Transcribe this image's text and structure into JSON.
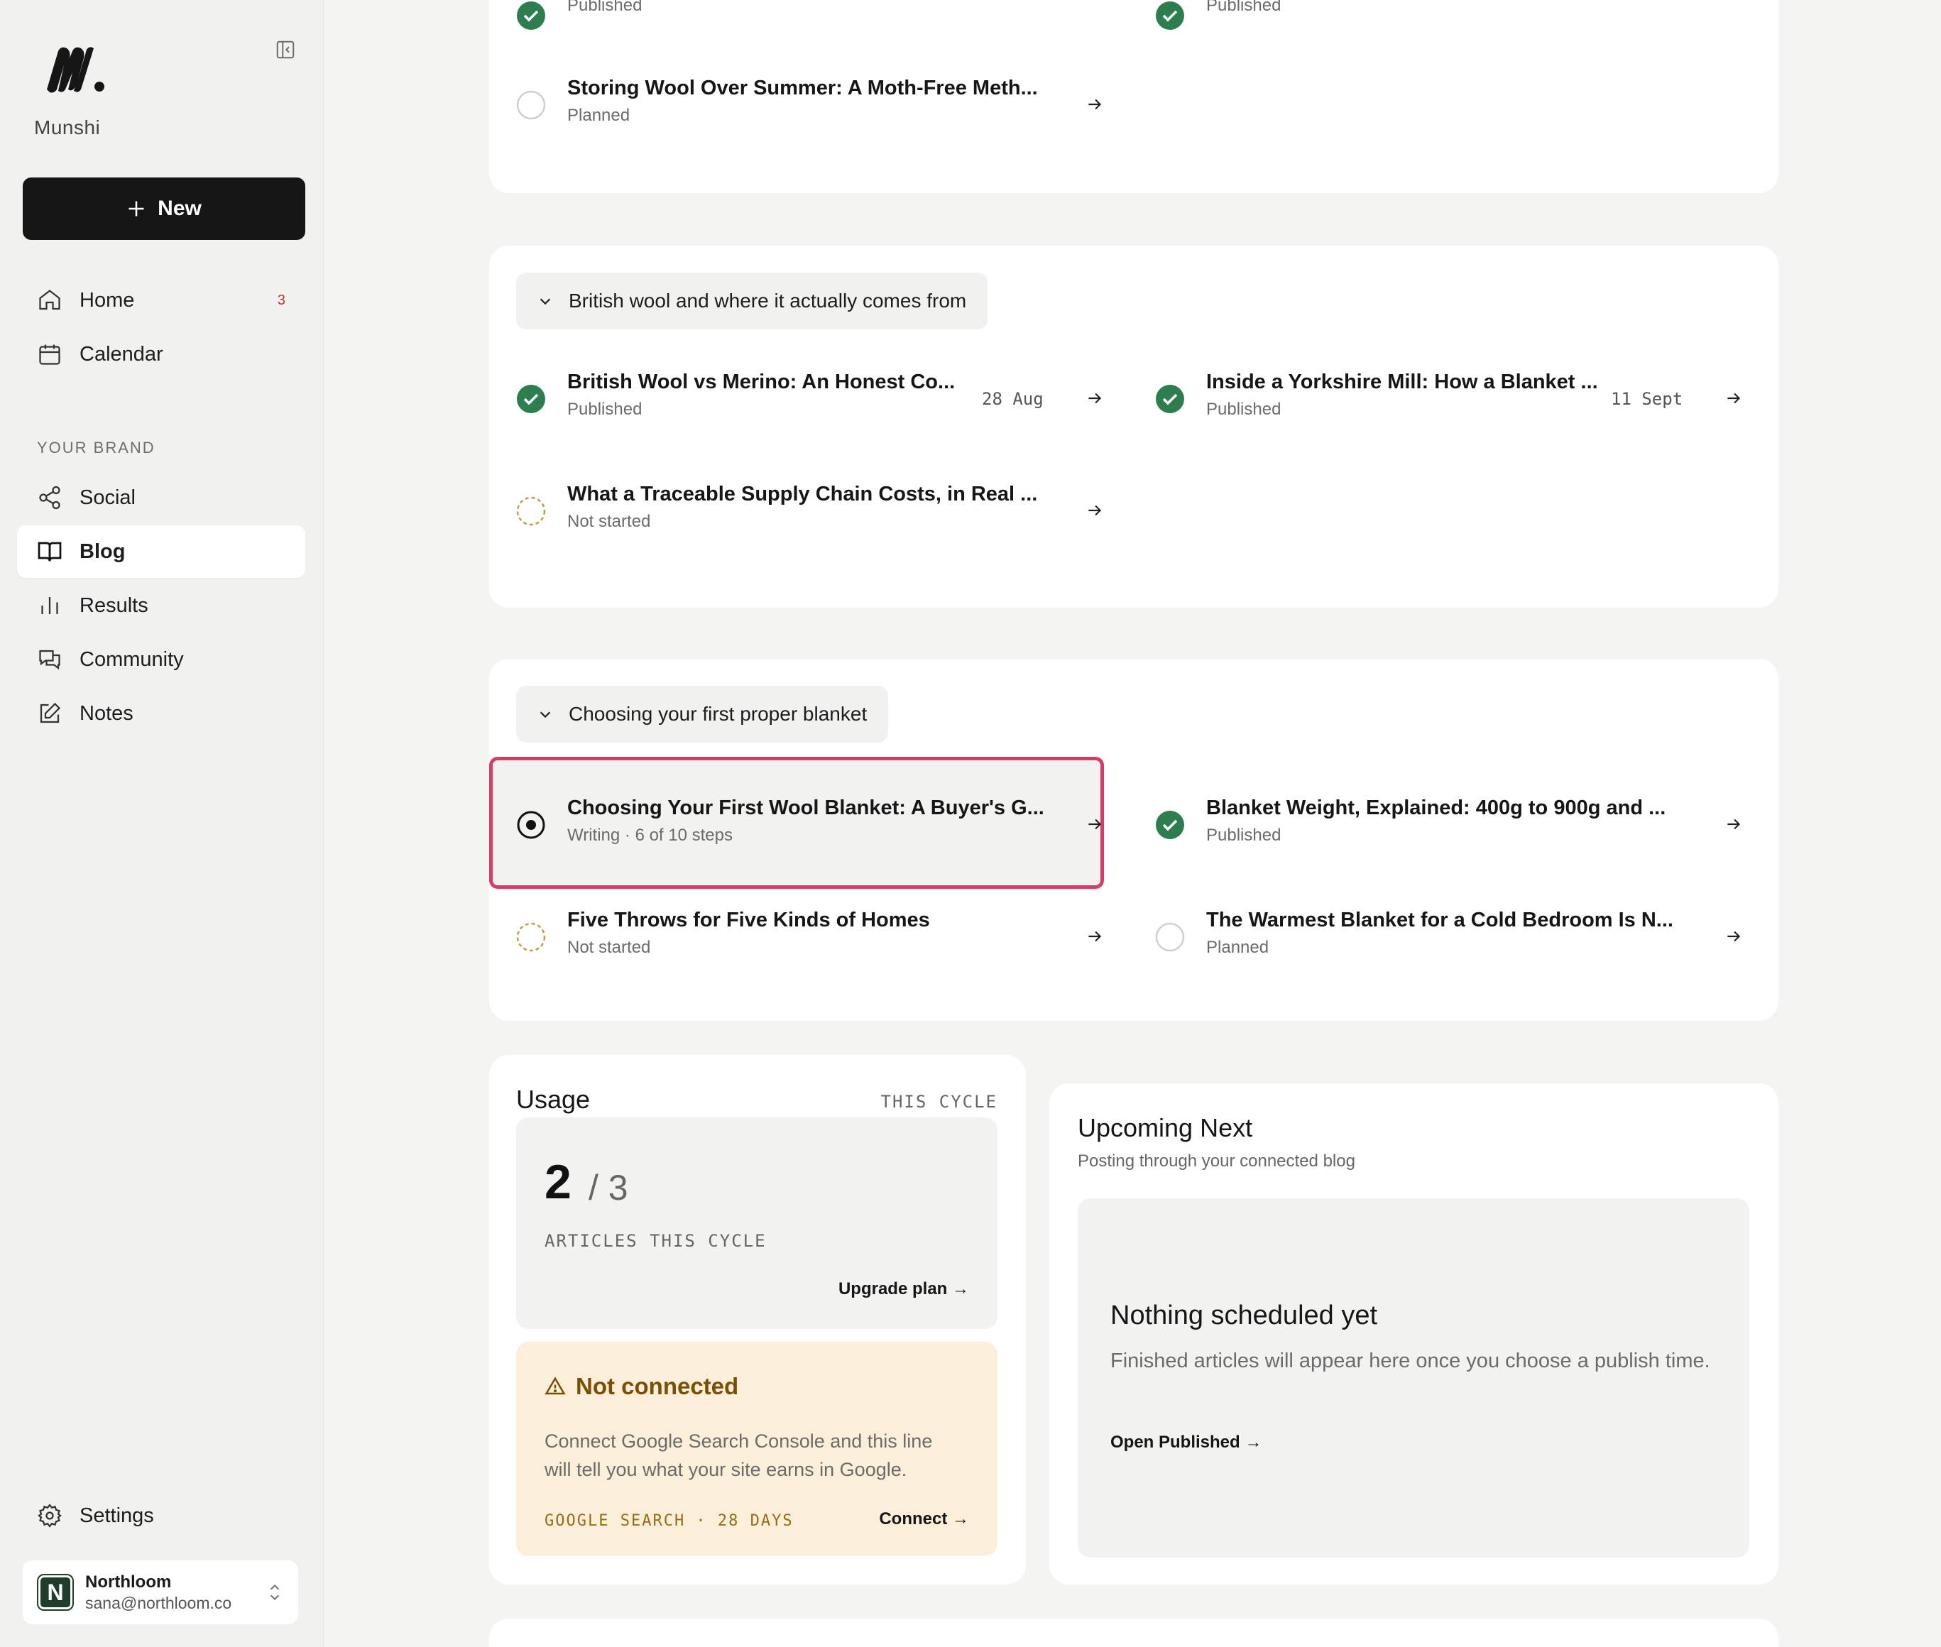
{
  "brand": {
    "name": "Munshi"
  },
  "sidebar": {
    "new_label": "New",
    "items": [
      {
        "label": "Home",
        "badge": "3"
      },
      {
        "label": "Calendar"
      }
    ],
    "section_label": "YOUR BRAND",
    "brand_items": [
      {
        "label": "Social"
      },
      {
        "label": "Blog"
      },
      {
        "label": "Results"
      },
      {
        "label": "Community"
      },
      {
        "label": "Notes"
      }
    ],
    "settings_label": "Settings",
    "account": {
      "initial": "N",
      "name": "Northloom",
      "email": "sana@northloom.co"
    }
  },
  "groups": [
    {
      "articles": [
        {
          "status_text": "Published"
        },
        {
          "status_text": "Published"
        },
        {
          "title": "Storing Wool Over Summer: A Moth-Free Meth...",
          "status_text": "Planned"
        }
      ]
    },
    {
      "name": "British wool and where it actually comes from",
      "articles": [
        {
          "title": "British Wool vs Merino: An Honest Co...",
          "status_text": "Published",
          "date": "28 Aug"
        },
        {
          "title": "Inside a Yorkshire Mill: How a Blanket ...",
          "status_text": "Published",
          "date": "11 Sept"
        },
        {
          "title": "What a Traceable Supply Chain Costs, in Real ...",
          "status_text": "Not started"
        }
      ]
    },
    {
      "name": "Choosing your first proper blanket",
      "articles": [
        {
          "title": "Choosing Your First Wool Blanket: A Buyer's G...",
          "status_text": "Writing · 6 of 10 steps"
        },
        {
          "title": "Blanket Weight, Explained: 400g to 900g and ...",
          "status_text": "Published"
        },
        {
          "title": "Five Throws for Five Kinds of Homes",
          "status_text": "Not started"
        },
        {
          "title": "The Warmest Blanket for a Cold Bedroom Is N...",
          "status_text": "Planned"
        }
      ]
    }
  ],
  "usage": {
    "title": "Usage",
    "cycle_label": "THIS CYCLE",
    "used": "2",
    "limit": "/ 3",
    "unit_label": "ARTICLES THIS CYCLE",
    "upgrade_label": "Upgrade plan →"
  },
  "connection": {
    "title": "Not connected",
    "text": "Connect Google Search Console and this line will tell you what your site earns in Google.",
    "footer": "GOOGLE SEARCH · 28 DAYS",
    "connect_label": "Connect →"
  },
  "upcoming": {
    "title": "Upcoming Next",
    "subtitle": "Posting through your connected blog",
    "empty_title": "Nothing scheduled yet",
    "empty_text": "Finished articles will appear here once you choose a publish time.",
    "link_label": "Open Published →"
  },
  "colors": {
    "accent": "#161616",
    "published": "#2e7d4f",
    "highlight": "#d93a66",
    "warning_bg": "#fbefd9"
  }
}
